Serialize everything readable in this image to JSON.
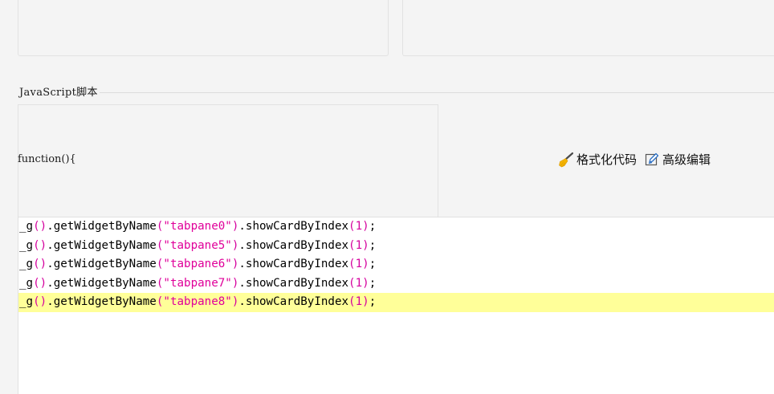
{
  "section": {
    "legend": "JavaScript脚本"
  },
  "function_header": "function(){",
  "toolbar": {
    "format_label": "格式化代码",
    "format_icon": "broom-icon",
    "advanced_label": "高级编辑",
    "advanced_icon": "edit-icon",
    "broom_color": "#f5b400"
  },
  "editor": {
    "highlight_color": "#ffff99",
    "token_color": "#d5009e",
    "lines": [
      {
        "prefix": "_g",
        "open": "(",
        "close": ")",
        "mid": ".getWidgetByName",
        "popen": "(",
        "string": "\"tabpane0\"",
        "pclose": ")",
        "method": ".showCardByIndex",
        "aopen": "(",
        "num": "1",
        "aclose": ")",
        "end": ";"
      },
      {
        "prefix": "_g",
        "open": "(",
        "close": ")",
        "mid": ".getWidgetByName",
        "popen": "(",
        "string": "\"tabpane5\"",
        "pclose": ")",
        "method": ".showCardByIndex",
        "aopen": "(",
        "num": "1",
        "aclose": ")",
        "end": ";"
      },
      {
        "prefix": "_g",
        "open": "(",
        "close": ")",
        "mid": ".getWidgetByName",
        "popen": "(",
        "string": "\"tabpane6\"",
        "pclose": ")",
        "method": ".showCardByIndex",
        "aopen": "(",
        "num": "1",
        "aclose": ")",
        "end": ";"
      },
      {
        "prefix": "_g",
        "open": "(",
        "close": ")",
        "mid": ".getWidgetByName",
        "popen": "(",
        "string": "\"tabpane7\"",
        "pclose": ")",
        "method": ".showCardByIndex",
        "aopen": "(",
        "num": "1",
        "aclose": ")",
        "end": ";"
      },
      {
        "prefix": "_g",
        "open": "(",
        "close": ")",
        "mid": ".getWidgetByName",
        "popen": "(",
        "string": "\"tabpane8\"",
        "pclose": ")",
        "method": ".showCardByIndex",
        "aopen": "(",
        "num": "1",
        "aclose": ")",
        "end": ";"
      }
    ],
    "active_line_index": 4
  }
}
